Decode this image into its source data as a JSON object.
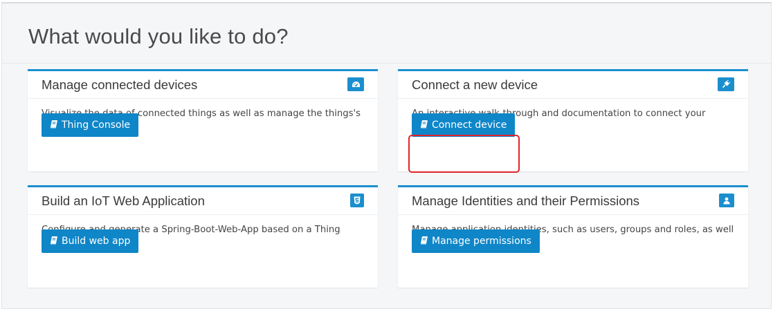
{
  "page": {
    "title": "What would you like to do?"
  },
  "cards": [
    {
      "title": "Manage connected devices",
      "icon": "dashboard-icon",
      "description": "Visualize the data of connected things as well as manage the things's permission.",
      "button_label": "Thing Console",
      "button_icon": "book-icon"
    },
    {
      "title": "Connect a new device",
      "icon": "plug-icon",
      "description": "An interactive walk-through and documentation to connect your device to the Suite.",
      "button_label": "Connect device",
      "button_icon": "book-icon",
      "highlighted": true
    },
    {
      "title": "Build an IoT Web Application",
      "icon": "html5-icon",
      "description": "Configure and generate a Spring-Boot-Web-App based on a Thing Type.",
      "button_label": "Build web app",
      "button_icon": "book-icon"
    },
    {
      "title": "Manage Identities and their Permissions",
      "icon": "user-icon",
      "description": "Manage application identities, such as users, groups and roles, as well as their permissions.",
      "button_label": "Manage permissions",
      "button_icon": "book-icon"
    }
  ],
  "colors": {
    "accent": "#1b8fce",
    "button": "#0f86c8",
    "highlight": "#e0232b",
    "background": "#f5f6f8"
  }
}
